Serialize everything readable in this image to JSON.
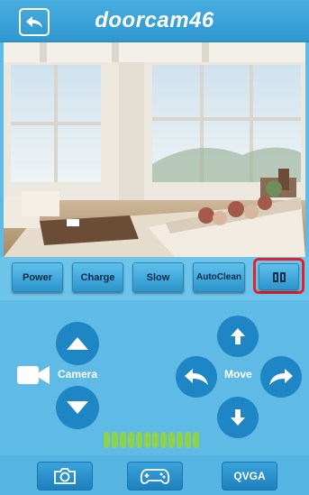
{
  "header": {
    "title": "doorcam46",
    "back_icon": "back-arrow-icon"
  },
  "functions": [
    {
      "label": "Power"
    },
    {
      "label": "Charge"
    },
    {
      "label": "Slow"
    },
    {
      "label": "AutoClean"
    }
  ],
  "pause_icon": "pause-icon",
  "controls": {
    "camera_label": "Camera",
    "move_label": "Move"
  },
  "level": {
    "segments": 12
  },
  "bottom": {
    "snapshot_icon": "camera-icon",
    "gamepad_icon": "gamepad-icon",
    "resolution_label": "QVGA"
  },
  "colors": {
    "header": "#2f97d0",
    "panel": "#5fbbe6",
    "button_dark": "#1e86c4",
    "highlight": "#e0232d",
    "level": "#8ed14a"
  }
}
